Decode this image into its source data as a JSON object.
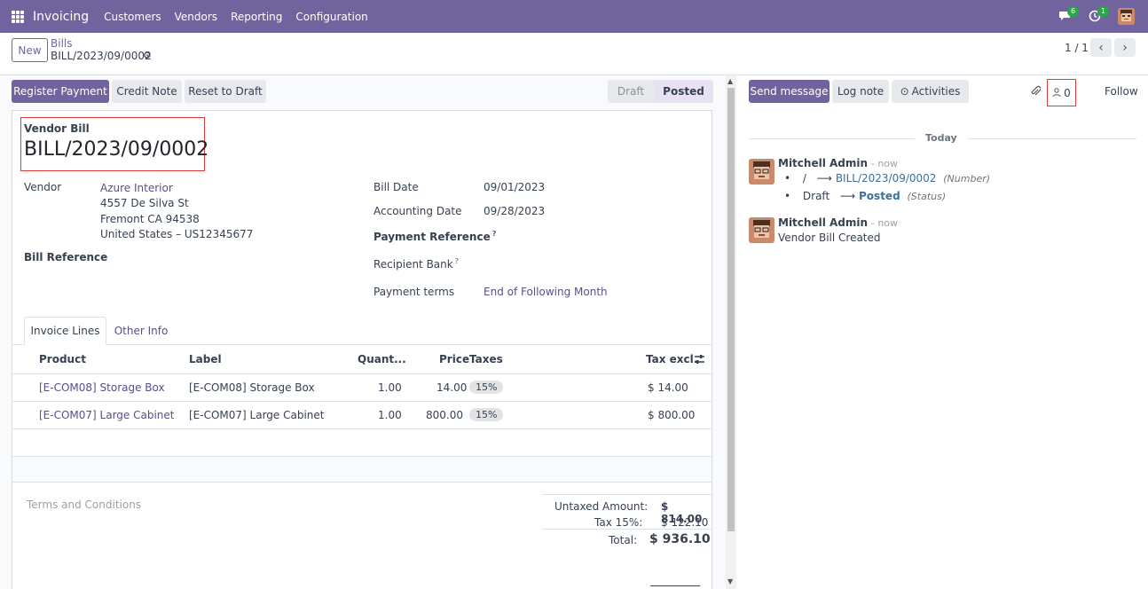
{
  "topbar": {
    "app_name": "Invoicing",
    "menu": [
      "Customers",
      "Vendors",
      "Reporting",
      "Configuration"
    ],
    "messages_count": "6",
    "activities_count": "1"
  },
  "control_panel": {
    "new_label": "New",
    "breadcrumb_parent": "Bills",
    "breadcrumb_current": "BILL/2023/09/0002",
    "pager": "1 / 1"
  },
  "actions": {
    "register_payment": "Register Payment",
    "credit_note": "Credit Note",
    "reset_to_draft": "Reset to Draft"
  },
  "statusbar": {
    "draft": "Draft",
    "posted": "Posted",
    "active": "Posted"
  },
  "form": {
    "doc_type": "Vendor Bill",
    "number": "BILL/2023/09/0002",
    "vendor_label": "Vendor",
    "vendor_name": "Azure Interior",
    "vendor_address": [
      "4557 De Silva St",
      "Fremont CA 94538",
      "United States – US12345677"
    ],
    "bill_reference_label": "Bill Reference",
    "bill_date_label": "Bill Date",
    "bill_date": "09/01/2023",
    "accounting_date_label": "Accounting Date",
    "accounting_date": "09/28/2023",
    "payment_reference_label": "Payment Reference",
    "recipient_bank_label": "Recipient Bank",
    "help_mark": "?",
    "payment_terms_label": "Payment terms",
    "payment_terms": "End of Following Month"
  },
  "tabs": {
    "invoice_lines": "Invoice Lines",
    "other_info": "Other Info"
  },
  "lines": {
    "headers": {
      "product": "Product",
      "label": "Label",
      "quantity": "Quant...",
      "price": "Price",
      "taxes": "Taxes",
      "tax_excl": "Tax excl."
    },
    "rows": [
      {
        "product": "[E-COM08] Storage Box",
        "label": "[E-COM08] Storage Box",
        "quantity": "1.00",
        "price": "14.00",
        "tax": "15%",
        "subtotal": "$ 14.00"
      },
      {
        "product": "[E-COM07] Large Cabinet",
        "label": "[E-COM07] Large Cabinet",
        "quantity": "1.00",
        "price": "800.00",
        "tax": "15%",
        "subtotal": "$ 800.00"
      }
    ]
  },
  "totals": {
    "terms_placeholder": "Terms and Conditions",
    "untaxed_label": "Untaxed Amount:",
    "untaxed": "$ 814.00",
    "tax_label": "Tax 15%:",
    "tax": "$ 122.10",
    "total_label": "Total:",
    "total": "$ 936.10"
  },
  "chatter": {
    "send_message": "Send message",
    "log_note": "Log note",
    "activities": "Activities",
    "followers_count": "0",
    "follow": "Follow",
    "date_separator": "Today",
    "messages": [
      {
        "author": "Mitchell Admin",
        "time": "- now",
        "changes": [
          {
            "old": "/",
            "new": "BILL/2023/09/0002",
            "field": "(Number)"
          },
          {
            "old": "Draft",
            "new": "Posted",
            "field": "(Status)"
          }
        ]
      },
      {
        "author": "Mitchell Admin",
        "time": "- now",
        "body": "Vendor Bill Created"
      }
    ]
  },
  "colors": {
    "brand": "#71639e",
    "highlight": "#e2393b"
  }
}
